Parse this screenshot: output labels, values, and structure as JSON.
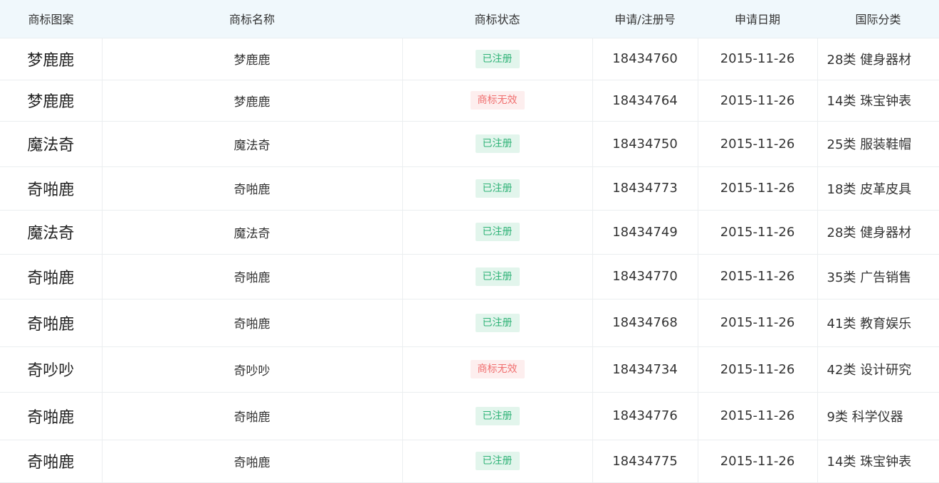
{
  "headers": [
    "商标图案",
    "商标名称",
    "商标状态",
    "申请/注册号",
    "申请日期",
    "国际分类"
  ],
  "colors": {
    "header_bg": "#f0f8fc",
    "status_registered_bg": "#e2f5ec",
    "status_registered_text": "#2eb276",
    "status_invalid_bg": "#fdeeee",
    "status_invalid_text": "#f06f6f"
  },
  "rows": [
    {
      "pattern": "梦鹿鹿",
      "name": "梦鹿鹿",
      "status": "已注册",
      "status_type": "ok",
      "reg_no": "18434760",
      "date": "2015-11-26",
      "class": "28类 健身器材"
    },
    {
      "pattern": "梦鹿鹿",
      "name": "梦鹿鹿",
      "status": "商标无效",
      "status_type": "bad",
      "reg_no": "18434764",
      "date": "2015-11-26",
      "class": "14类 珠宝钟表"
    },
    {
      "pattern": "魔法奇",
      "name": "魔法奇",
      "status": "已注册",
      "status_type": "ok",
      "reg_no": "18434750",
      "date": "2015-11-26",
      "class": "25类 服装鞋帽"
    },
    {
      "pattern": "奇啪鹿",
      "name": "奇啪鹿",
      "status": "已注册",
      "status_type": "ok",
      "reg_no": "18434773",
      "date": "2015-11-26",
      "class": "18类 皮革皮具"
    },
    {
      "pattern": "魔法奇",
      "name": "魔法奇",
      "status": "已注册",
      "status_type": "ok",
      "reg_no": "18434749",
      "date": "2015-11-26",
      "class": "28类 健身器材"
    },
    {
      "pattern": "奇啪鹿",
      "name": "奇啪鹿",
      "status": "已注册",
      "status_type": "ok",
      "reg_no": "18434770",
      "date": "2015-11-26",
      "class": "35类 广告销售"
    },
    {
      "pattern": "奇啪鹿",
      "name": "奇啪鹿",
      "status": "已注册",
      "status_type": "ok",
      "reg_no": "18434768",
      "date": "2015-11-26",
      "class": "41类 教育娱乐"
    },
    {
      "pattern": "奇吵吵",
      "name": "奇吵吵",
      "status": "商标无效",
      "status_type": "bad",
      "reg_no": "18434734",
      "date": "2015-11-26",
      "class": "42类 设计研究"
    },
    {
      "pattern": "奇啪鹿",
      "name": "奇啪鹿",
      "status": "已注册",
      "status_type": "ok",
      "reg_no": "18434776",
      "date": "2015-11-26",
      "class": "9类 科学仪器"
    },
    {
      "pattern": "奇啪鹿",
      "name": "奇啪鹿",
      "status": "已注册",
      "status_type": "ok",
      "reg_no": "18434775",
      "date": "2015-11-26",
      "class": "14类 珠宝钟表"
    }
  ]
}
